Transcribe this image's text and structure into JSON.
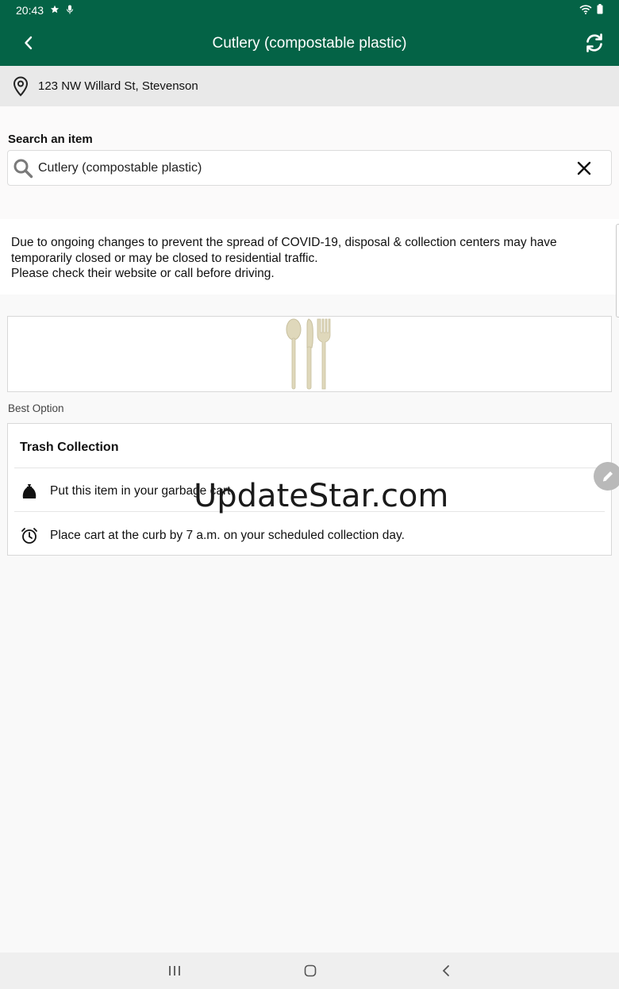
{
  "status_bar": {
    "time": "20:43"
  },
  "header": {
    "title": "Cutlery (compostable plastic)"
  },
  "location": {
    "address": "123 NW Willard St, Stevenson"
  },
  "search": {
    "label": "Search an item",
    "value": "Cutlery (compostable plastic)"
  },
  "notice": {
    "line1": "Due to ongoing changes to prevent the spread of COVID-19, disposal & collection centers may have temporarily closed or may be closed to residential traffic.",
    "line2": "Please check their website or call before driving."
  },
  "item_image": {
    "icon": "cutlery-icon"
  },
  "best_option": {
    "label": "Best Option",
    "title": "Trash Collection",
    "steps": [
      {
        "icon": "garbage-bag-icon",
        "text": "Put this item in your garbage cart."
      },
      {
        "icon": "alarm-clock-icon",
        "text": "Place cart at the curb by 7 a.m. on your scheduled collection day."
      }
    ]
  },
  "watermark": "UpdateStar.com",
  "colors": {
    "primary": "#046346",
    "background": "#f9f9f9",
    "address_bar": "#e9e9e9"
  }
}
